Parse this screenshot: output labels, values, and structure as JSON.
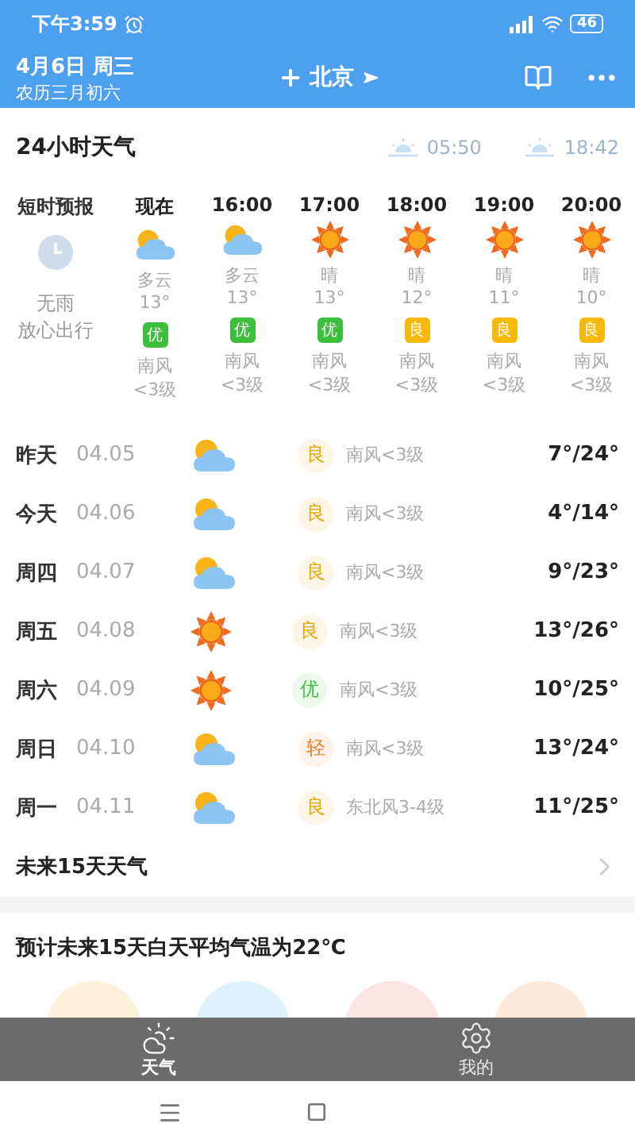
{
  "status_bar": {
    "time": "下午3:59",
    "battery": "46"
  },
  "header": {
    "date": "4月6日 周三",
    "lunar": "农历三月初六",
    "city": "北京"
  },
  "hourly_section": {
    "title": "24小时天气",
    "sunrise": "05:50",
    "sunset": "18:42"
  },
  "nowcast": {
    "title": "短时预报",
    "lines": [
      "无雨",
      "放心出行"
    ]
  },
  "hours": [
    {
      "time": "现在",
      "kind": "cloudy",
      "condition": "多云",
      "temp": "13°",
      "aqi": "优",
      "color": "#3dbf3d",
      "wind": "南风",
      "wind_level": "<3级"
    },
    {
      "time": "16:00",
      "kind": "cloudy",
      "condition": "多云",
      "temp": "13°",
      "aqi": "优",
      "color": "#3dbf3d",
      "wind": "南风",
      "wind_level": "<3级"
    },
    {
      "time": "17:00",
      "kind": "sunny",
      "condition": "晴",
      "temp": "13°",
      "aqi": "优",
      "color": "#3dbf3d",
      "wind": "南风",
      "wind_level": "<3级"
    },
    {
      "time": "18:00",
      "kind": "sunny",
      "condition": "晴",
      "temp": "12°",
      "aqi": "良",
      "color": "#f5b90a",
      "wind": "南风",
      "wind_level": "<3级"
    },
    {
      "time": "19:00",
      "kind": "sunny",
      "condition": "晴",
      "temp": "11°",
      "aqi": "良",
      "color": "#f5b90a",
      "wind": "南风",
      "wind_level": "<3级"
    },
    {
      "time": "20:00",
      "kind": "sunny",
      "condition": "晴",
      "temp": "10°",
      "aqi": "良",
      "color": "#f5b90a",
      "wind": "南风",
      "wind_level": "<3级"
    }
  ],
  "days": [
    {
      "day": "昨天",
      "date": "04.05",
      "kind": "cloudy",
      "aqi": "良",
      "color": "#e8a400",
      "wind": "南风<3级",
      "temps": "7°/24°"
    },
    {
      "day": "今天",
      "date": "04.06",
      "kind": "cloudy",
      "aqi": "良",
      "color": "#e8a400",
      "wind": "南风<3级",
      "temps": "4°/14°"
    },
    {
      "day": "周四",
      "date": "04.07",
      "kind": "cloudy",
      "aqi": "良",
      "color": "#e8a400",
      "wind": "南风<3级",
      "temps": "9°/23°"
    },
    {
      "day": "周五",
      "date": "04.08",
      "kind": "sunny",
      "aqi": "良",
      "color": "#e8a400",
      "wind": "南风<3级",
      "temps": "13°/26°"
    },
    {
      "day": "周六",
      "date": "04.09",
      "kind": "sunny",
      "aqi": "优",
      "color": "#3dbf3d",
      "wind": "南风<3级",
      "temps": "10°/25°"
    },
    {
      "day": "周日",
      "date": "04.10",
      "kind": "cloudy",
      "aqi": "轻",
      "color": "#f07d1e",
      "wind": "南风<3级",
      "temps": "13°/24°"
    },
    {
      "day": "周一",
      "date": "04.11",
      "kind": "cloudy",
      "aqi": "良",
      "color": "#e8a400",
      "wind": "东北风3-4级",
      "temps": "11°/25°"
    }
  ],
  "forecast_15": {
    "title": "未来15天天气"
  },
  "summary": {
    "text": "预计未来15天白天平均气温为22℃"
  },
  "features": [
    {
      "color": "#fdf1dc"
    },
    {
      "color": "#def2fb"
    },
    {
      "color": "#fbe4e4"
    },
    {
      "color": "#fdeadb"
    }
  ],
  "tabs": [
    {
      "label": "天气",
      "kind": "weather",
      "selected": true
    },
    {
      "label": "我的",
      "kind": "settings",
      "selected": false
    }
  ]
}
